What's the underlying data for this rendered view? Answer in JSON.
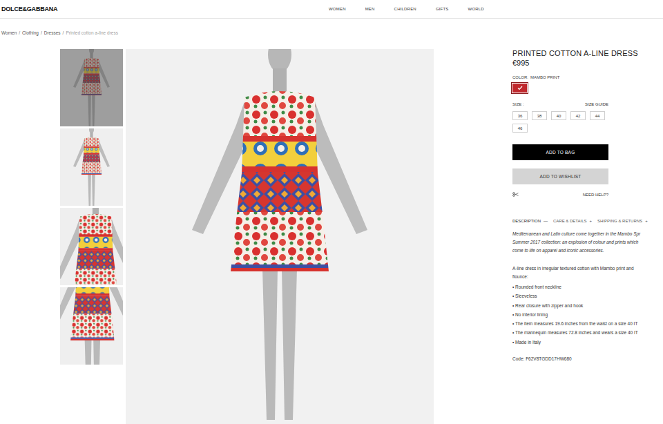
{
  "header": {
    "logo": "DOLCE&GABBANA",
    "nav": [
      {
        "label": "WOMEN"
      },
      {
        "label": "MEN"
      },
      {
        "label": "CHILDREN"
      },
      {
        "label": "GIFTS"
      },
      {
        "label": "WORLD"
      }
    ]
  },
  "breadcrumb": {
    "separator": "/",
    "items": [
      {
        "label": "Women",
        "current": false
      },
      {
        "label": "Clothing",
        "current": false
      },
      {
        "label": "Dresses",
        "current": false
      },
      {
        "label": "Printed cotton a-line dress",
        "current": true
      }
    ]
  },
  "gallery": {
    "thumbnails": [
      {
        "selected": true
      },
      {
        "selected": false
      },
      {
        "selected": false
      },
      {
        "selected": false
      }
    ]
  },
  "product": {
    "title": "PRINTED COTTON A-LINE DRESS",
    "price": "€995",
    "color_label": "COLOR:",
    "color_name": "MAMBO PRINT",
    "swatches": [
      {
        "selected": true,
        "color": "#c0282d"
      }
    ],
    "size_label": "SIZE :",
    "size_guide": "SIZE GUIDE",
    "sizes": [
      {
        "label": "36",
        "selected": false
      },
      {
        "label": "38",
        "selected": false
      },
      {
        "label": "40",
        "selected": false
      },
      {
        "label": "42",
        "selected": false
      },
      {
        "label": "44",
        "selected": false
      },
      {
        "label": "46",
        "selected": false
      }
    ],
    "add_to_bag": "ADD TO BAG",
    "add_to_wishlist": "ADD TO WISHLIST",
    "need_help": "NEED HELP?",
    "tabs": [
      {
        "label": "DESCRIPTION",
        "sign": "—",
        "selected": true
      },
      {
        "label": "CARE & DETAILS",
        "sign": "+",
        "selected": false
      },
      {
        "label": "SHIPPING & RETURNS",
        "sign": "+",
        "selected": false
      }
    ],
    "intro": [
      "Mediterranean and Latin culture come together in the Mambo Spr",
      "Summer 2017 collection: an explosion of colour and prints which",
      "come to life on apparel and iconic accessories."
    ],
    "details": [
      "A-line dress in irregular textured cotton with Mambo print and",
      "flounce:"
    ],
    "bullets": [
      "• Rounded front neckline",
      "• Sleeveless",
      "• Rear closure with zipper and hook",
      "• No interior lining",
      "• The item measures 19.6 inches from the waist on a size 40 IT",
      "• The mannequin measures 72.8 inches and wears a size 40 IT",
      "• Made in Italy"
    ],
    "code": "Code: F62V8TGDD17HW680"
  }
}
